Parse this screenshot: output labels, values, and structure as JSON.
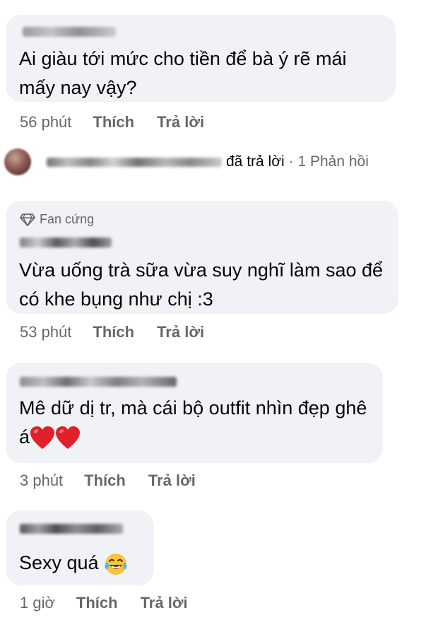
{
  "comments": [
    {
      "text": "Ai giàu tới mức cho tiền để bà ý rẽ mái mấy nay vậy?",
      "time": "56 phút",
      "like": "Thích",
      "reply": "Trả lời"
    },
    {
      "badge": "Fan cứng",
      "text": "Vừa uống trà sữa vừa suy nghĩ làm sao để có khe bụng như chị :3",
      "time": "53 phút",
      "like": "Thích",
      "reply": "Trả lời"
    },
    {
      "text": "Mê dữ dị tr, mà cái bộ outfit nhìn đẹp ghê á",
      "time": "3 phút",
      "like": "Thích",
      "reply": "Trả lời"
    },
    {
      "text": "Sexy quá",
      "time": "1 giờ",
      "like": "Thích",
      "reply": "Trả lời"
    }
  ],
  "reply_summary": {
    "replied": "đã trả lời",
    "count": "· 1 Phản hồi"
  },
  "icons": {
    "fan_badge": "diamond-icon",
    "hearts": "red-heart-emoji",
    "laugh": "tears-of-joy-emoji"
  },
  "colors": {
    "bubble": "#f0f2f5",
    "meta": "#65676b",
    "text": "#050505"
  }
}
